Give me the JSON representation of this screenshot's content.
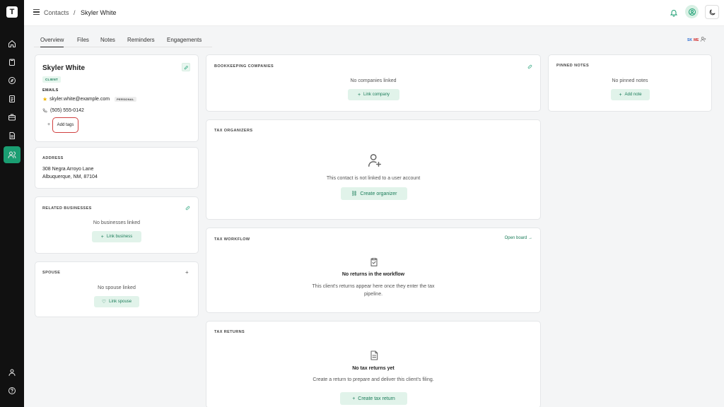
{
  "app": {
    "logo_glyph": "T"
  },
  "breadcrumb": {
    "section": "Contacts",
    "separator": "/",
    "current": "Skyler White"
  },
  "tabs": [
    "Overview",
    "Files",
    "Notes",
    "Reminders",
    "Engagements"
  ],
  "collaborators": {
    "a": "SK",
    "b": "ME"
  },
  "contact": {
    "name": "Skyler White",
    "badge": "CLIENT",
    "emails_label": "EMAILS",
    "email": "skyler.white@example.com",
    "email_tag": "PERSONAL",
    "phone": "(505) 555-0142",
    "add_tags": "Add tags",
    "plus": "+"
  },
  "address": {
    "title": "ADDRESS",
    "line1": "308 Negra Arroyo Lane",
    "line2": "Albuquerque, NM, 87104"
  },
  "related": {
    "title": "RELATED BUSINESSES",
    "empty": "No businesses linked",
    "button": "Link business"
  },
  "spouse": {
    "title": "SPOUSE",
    "empty": "No spouse linked",
    "button": "Link spouse",
    "plus": "+"
  },
  "bookkeeping": {
    "title": "BOOKKEEPING COMPANIES",
    "empty": "No companies linked",
    "button": "Link company"
  },
  "organizers": {
    "title": "TAX ORGANIZERS",
    "message": "This contact is not linked to a user account",
    "button": "Create organizer"
  },
  "workflow": {
    "title": "TAX WORKFLOW",
    "link": "Open board →",
    "heading": "No returns in the workflow",
    "desc1": "This client's returns appear here once they enter the tax",
    "desc2": "pipeline."
  },
  "returns": {
    "title": "TAX RETURNS",
    "heading": "No tax returns yet",
    "desc": "Create a return to prepare and deliver this client's filing.",
    "button": "Create tax return"
  },
  "pinned": {
    "title": "PINNED NOTES",
    "empty": "No pinned notes",
    "button": "Add note"
  },
  "colors": {
    "accent": "#1a9e72",
    "sidebar": "#111111",
    "highlight": "#d04040"
  }
}
